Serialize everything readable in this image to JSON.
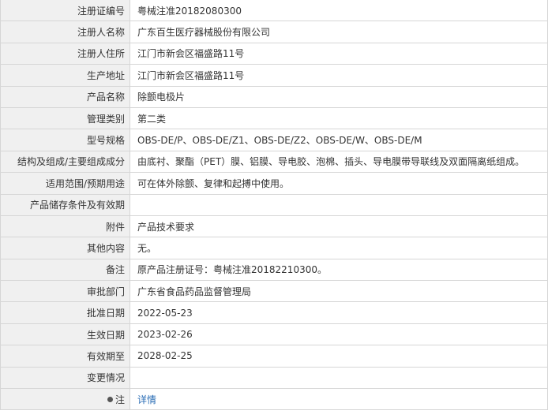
{
  "rows": [
    {
      "label": "注册证编号",
      "value": "粤械注准20182080300"
    },
    {
      "label": "注册人名称",
      "value": "广东百生医疗器械股份有限公司"
    },
    {
      "label": "注册人住所",
      "value": "江门市新会区福盛路11号"
    },
    {
      "label": "生产地址",
      "value": "江门市新会区福盛路11号"
    },
    {
      "label": "产品名称",
      "value": "除颤电极片"
    },
    {
      "label": "管理类别",
      "value": "第二类"
    },
    {
      "label": "型号规格",
      "value": "OBS-DE/P、OBS-DE/Z1、OBS-DE/Z2、OBS-DE/W、OBS-DE/M"
    },
    {
      "label": "结构及组成/主要组成成分",
      "value": "由底衬、聚酯（PET）膜、铝膜、导电胶、泡棉、插头、导电膜带导联线及双面隔离纸组成。"
    },
    {
      "label": "适用范围/预期用途",
      "value": "可在体外除颤、复律和起搏中使用。"
    },
    {
      "label": "产品储存条件及有效期",
      "value": ""
    },
    {
      "label": "附件",
      "value": "产品技术要求"
    },
    {
      "label": "其他内容",
      "value": "无。"
    },
    {
      "label": "备注",
      "value": "原产品注册证号：粤械注准20182210300。"
    },
    {
      "label": "审批部门",
      "value": "广东省食品药品监督管理局"
    },
    {
      "label": "批准日期",
      "value": "2022-05-23"
    },
    {
      "label": "生效日期",
      "value": "2023-02-26"
    },
    {
      "label": "有效期至",
      "value": "2028-02-25"
    },
    {
      "label": "变更情况",
      "value": ""
    }
  ],
  "note": {
    "label": "注",
    "link_text": "详情",
    "icon": "info-dot-icon"
  },
  "colors": {
    "label_bg": "#f0f0f0",
    "border": "#d6d6d6",
    "link": "#2a6db5"
  }
}
